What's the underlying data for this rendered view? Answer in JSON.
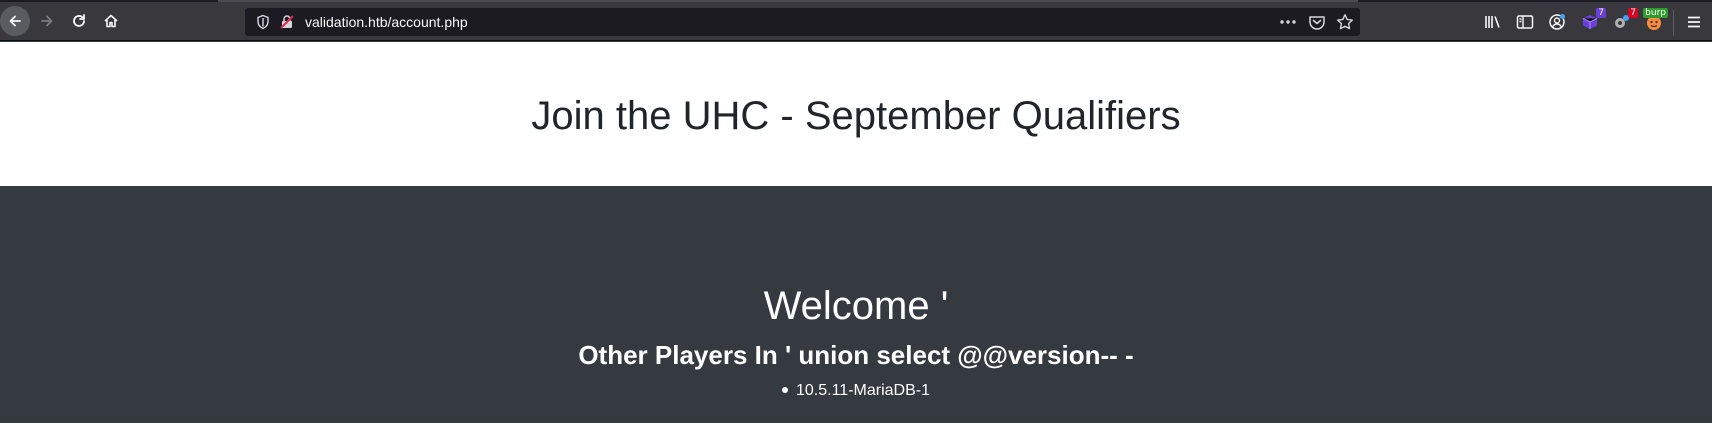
{
  "browser": {
    "url": "validation.htb/account.php",
    "badges": {
      "extension_purple": "7",
      "extension_red": "7",
      "burp": "burp"
    },
    "colors": {
      "toolbar": "#38383d",
      "urlbar": "#1c1b22",
      "badge_purple": "#6a3fd9",
      "badge_red": "#d70022",
      "badge_burp": "#2e9d2e"
    }
  },
  "page": {
    "title": "Join the UHC - September Qualifiers",
    "welcome": "Welcome '",
    "players_heading": "Other Players In ' union select @@version-- -",
    "players": [
      "10.5.11-MariaDB-1"
    ],
    "colors": {
      "header_bg": "#ffffff",
      "body_bg": "#343a40",
      "title": "#212529",
      "body_text": "#ffffff"
    }
  }
}
